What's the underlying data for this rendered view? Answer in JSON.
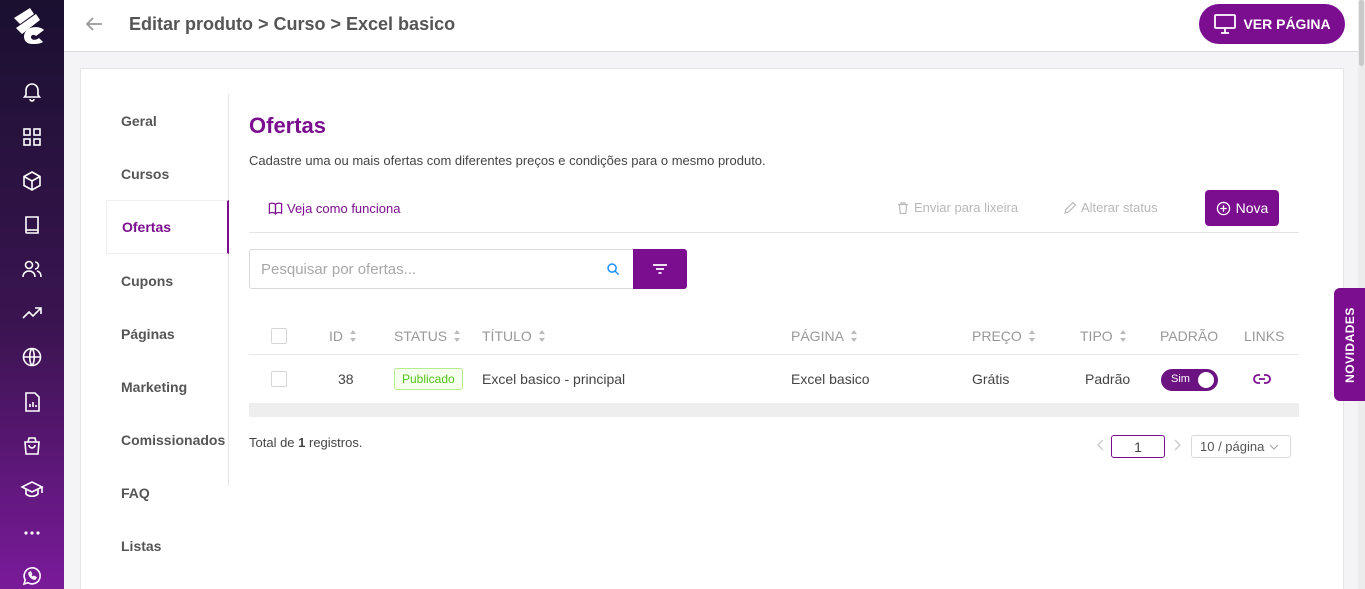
{
  "header": {
    "breadcrumb": "Editar produto > Curso > Excel basico",
    "view_page_label": "VER PÁGINA"
  },
  "sidebar": {
    "icons": [
      "bell-icon",
      "dashboard-icon",
      "box-icon",
      "book-icon",
      "users-icon",
      "trending-icon",
      "globe-icon",
      "report-icon",
      "shopping-bag-icon",
      "graduation-cap-icon",
      "more-icon",
      "whatsapp-icon"
    ]
  },
  "subnav": {
    "items": [
      {
        "label": "Geral"
      },
      {
        "label": "Cursos"
      },
      {
        "label": "Ofertas",
        "active": true
      },
      {
        "label": "Cupons"
      },
      {
        "label": "Páginas"
      },
      {
        "label": "Marketing"
      },
      {
        "label": "Comissionados"
      },
      {
        "label": "FAQ"
      },
      {
        "label": "Listas"
      }
    ]
  },
  "main": {
    "title": "Ofertas",
    "subtitle": "Cadastre uma ou mais ofertas com diferentes preços e condições para o mesmo produto.",
    "help_link": "Veja como funciona",
    "trash_label": "Enviar para lixeira",
    "status_label": "Alterar status",
    "new_label": "Nova",
    "search_placeholder": "Pesquisar por ofertas..."
  },
  "table": {
    "headers": [
      "ID",
      "STATUS",
      "TÍTULO",
      "PÁGINA",
      "PREÇO",
      "TIPO",
      "PADRÃO",
      "LINKS"
    ],
    "rows": [
      {
        "id": "38",
        "status": "Publicado",
        "title": "Excel basico - principal",
        "page": "Excel basico",
        "price": "Grátis",
        "type": "Padrão",
        "default": "Sim"
      }
    ]
  },
  "pagination": {
    "total_prefix": "Total de ",
    "total_count": "1",
    "total_suffix": " registros.",
    "current_page": "1",
    "page_size": "10 / página"
  },
  "side_tab": {
    "label": "NOVIDADES"
  },
  "colors": {
    "accent": "#7b0e8e",
    "success": "#52c41a"
  }
}
